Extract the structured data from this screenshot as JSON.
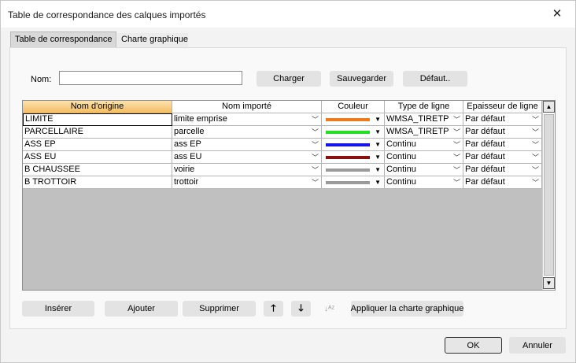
{
  "window": {
    "title": "Table de correspondance des calques importés",
    "close_glyph": "✕"
  },
  "tabs": [
    {
      "label": "Table de correspondance",
      "active": true
    },
    {
      "label": "Charte graphique",
      "active": false
    }
  ],
  "name_field": {
    "label": "Nom:",
    "value": ""
  },
  "top_buttons": {
    "load": "Charger",
    "save": "Sauvegarder",
    "default": "Défaut.."
  },
  "table": {
    "columns": [
      "Nom d'origine",
      "Nom importé",
      "Couleur",
      "Type de ligne",
      "Epaisseur de ligne"
    ],
    "rows": [
      {
        "origin": "LIMITE",
        "imported": "limite emprise",
        "color": "#f07a1e",
        "linetype": "WMSA_TIRETP",
        "thickness": "Par défaut"
      },
      {
        "origin": "PARCELLAIRE",
        "imported": "parcelle",
        "color": "#22e022",
        "linetype": "WMSA_TIRETP",
        "thickness": "Par défaut"
      },
      {
        "origin": "ASS EP",
        "imported": "ass EP",
        "color": "#1414e6",
        "linetype": "Continu",
        "thickness": "Par défaut"
      },
      {
        "origin": "ASS EU",
        "imported": "ass EU",
        "color": "#8a1010",
        "linetype": "Continu",
        "thickness": "Par défaut"
      },
      {
        "origin": "B CHAUSSEE",
        "imported": "voirie",
        "color": "#9b9b9b",
        "linetype": "Continu",
        "thickness": "Par défaut"
      },
      {
        "origin": "B TROTTOIR",
        "imported": "trottoir",
        "color": "#9b9b9b",
        "linetype": "Continu",
        "thickness": "Par défaut"
      }
    ]
  },
  "bottom_buttons": {
    "insert": "Insérer",
    "add": "Ajouter",
    "delete": "Supprimer",
    "move_up": "🡑",
    "move_down": "🡓",
    "sort": "↓ᴬᶻ",
    "apply": "Appliquer la charte graphique"
  },
  "dialog_buttons": {
    "ok": "OK",
    "cancel": "Annuler"
  },
  "icons": {
    "dropdown": "chevron-down-icon",
    "scroll_up": "triangle-up-icon",
    "scroll_down": "triangle-down-icon"
  }
}
